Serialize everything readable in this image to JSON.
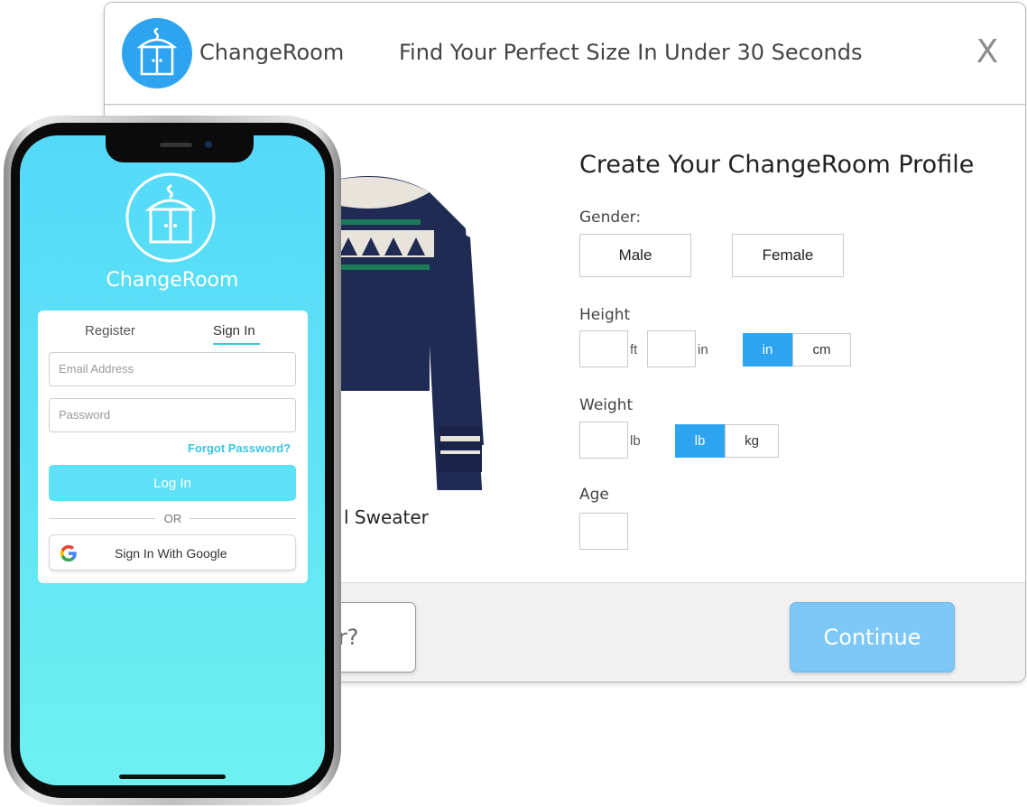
{
  "modal": {
    "brand_name": "ChangeRoom",
    "tagline": "Find Your Perfect Size In Under 30 Seconds",
    "close_label": "X",
    "product_name": "l Sweater",
    "form": {
      "title": "Create Your ChangeRoom Profile",
      "gender_label": "Gender:",
      "gender_options": [
        "Male",
        "Female"
      ],
      "height_label": "Height",
      "height_units": {
        "ft": "ft",
        "in": "in"
      },
      "height_toggle": [
        "in",
        "cm"
      ],
      "height_toggle_selected": "in",
      "weight_label": "Weight",
      "weight_unit": "lb",
      "weight_toggle": [
        "lb",
        "kg"
      ],
      "weight_toggle_selected": "lb",
      "age_label": "Age"
    },
    "footer": {
      "member_label": "nber?",
      "continue_label": "Continue"
    },
    "colors": {
      "accent": "#2ea4f1",
      "continue": "#7ec8f7"
    }
  },
  "phone": {
    "app_name": "ChangeRoom",
    "tabs": {
      "register": "Register",
      "sign_in": "Sign In"
    },
    "email_placeholder": "Email Address",
    "password_placeholder": "Password",
    "forgot_label": "Forgot Password?",
    "login_label": "Log In",
    "or_label": "OR",
    "google_label": "Sign In With Google",
    "colors": {
      "screen": "#5fe3f6",
      "accent": "#38c4e6"
    }
  }
}
